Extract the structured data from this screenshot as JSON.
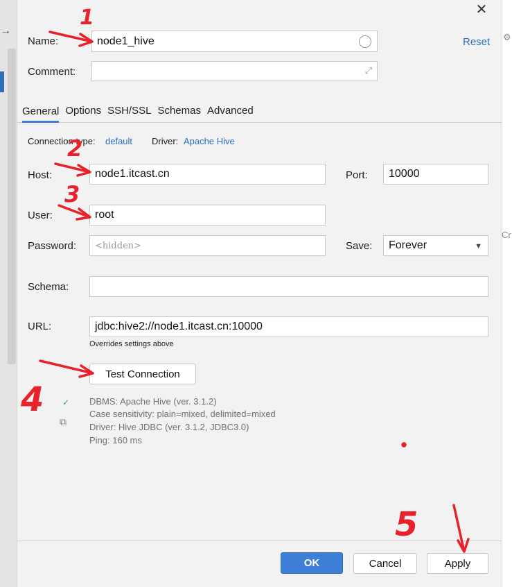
{
  "dialog": {
    "close_icon": "close-icon",
    "reset_label": "Reset",
    "name_label": "Name:",
    "name_value": "node1_hive",
    "comment_label": "Comment:",
    "comment_value": ""
  },
  "tabs": [
    {
      "label": "General",
      "active": true
    },
    {
      "label": "Options"
    },
    {
      "label": "SSH/SSL"
    },
    {
      "label": "Schemas"
    },
    {
      "label": "Advanced"
    }
  ],
  "general": {
    "connection_type_label": "Connection type:",
    "connection_type_value": "default",
    "driver_label": "Driver:",
    "driver_value": "Apache Hive",
    "host_label": "Host:",
    "host_value": "node1.itcast.cn",
    "port_label": "Port:",
    "port_value": "10000",
    "user_label": "User:",
    "user_value": "root",
    "password_label": "Password:",
    "password_placeholder": "<hidden>",
    "save_label": "Save:",
    "save_value": "Forever",
    "schema_label": "Schema:",
    "schema_value": "",
    "url_label": "URL:",
    "url_value": "jdbc:hive2://node1.itcast.cn:10000",
    "url_note": "Overrides settings above",
    "test_connection_label": "Test Connection"
  },
  "test_result": {
    "dbms": "DBMS: Apache Hive (ver. 3.1.2)",
    "case_sensitivity": "Case sensitivity: plain=mixed, delimited=mixed",
    "driver": "Driver: Hive JDBC (ver. 3.1.2, JDBC3.0)",
    "ping": "Ping: 160 ms"
  },
  "footer": {
    "ok_label": "OK",
    "cancel_label": "Cancel",
    "apply_label": "Apply"
  },
  "side": {
    "left_icon": "arrow-right-icon",
    "right_partial_text": "Cr"
  },
  "annotations": {
    "numbers": [
      "1",
      "2",
      "3",
      "4",
      "5"
    ],
    "color": "#e8222b"
  },
  "colors": {
    "accent": "#3c7fd6",
    "link": "#2a6ebd"
  }
}
